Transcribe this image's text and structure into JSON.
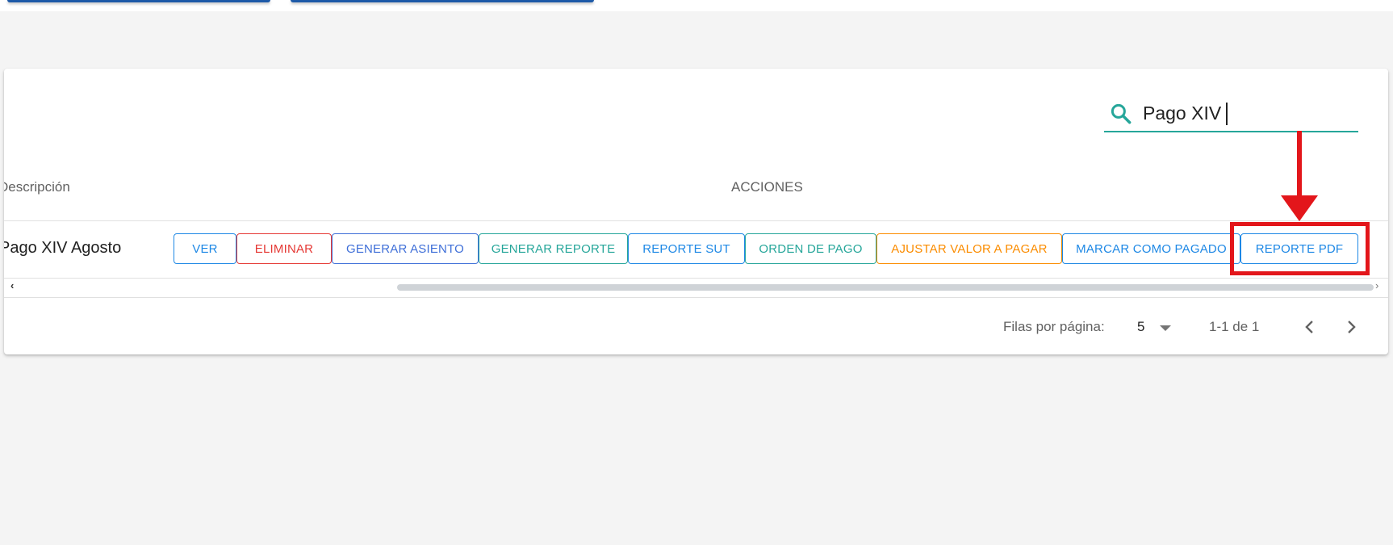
{
  "search": {
    "value": "Pago XIV",
    "icon": "search-icon"
  },
  "table": {
    "headers": {
      "description": "Descripción",
      "actions": "ACCIONES"
    },
    "rows": [
      {
        "description": "Pago XIV Agosto"
      }
    ],
    "actions": [
      {
        "label": "VER",
        "color": "#1e88e5"
      },
      {
        "label": "ELIMINAR",
        "color": "#e53935"
      },
      {
        "label": "GENERAR ASIENTO",
        "color": "#3f6fd8"
      },
      {
        "label": "GENERAR REPORTE",
        "color": "#26a69a"
      },
      {
        "label": "REPORTE SUT",
        "color": "#1e88e5"
      },
      {
        "label": "ORDEN DE PAGO",
        "color": "#26a69a"
      },
      {
        "label": "AJUSTAR VALOR A PAGAR",
        "color": "#fb8c00"
      },
      {
        "label": "MARCAR COMO PAGADO",
        "color": "#1e88e5"
      },
      {
        "label": "REPORTE PDF",
        "color": "#1e88e5"
      }
    ]
  },
  "pagination": {
    "rows_per_page_label": "Filas por página:",
    "rows_per_page_value": "5",
    "range_text": "1-1 de 1"
  },
  "annotation": {
    "color": "#e3161b"
  },
  "colors": {
    "accent": "#26a69a"
  }
}
